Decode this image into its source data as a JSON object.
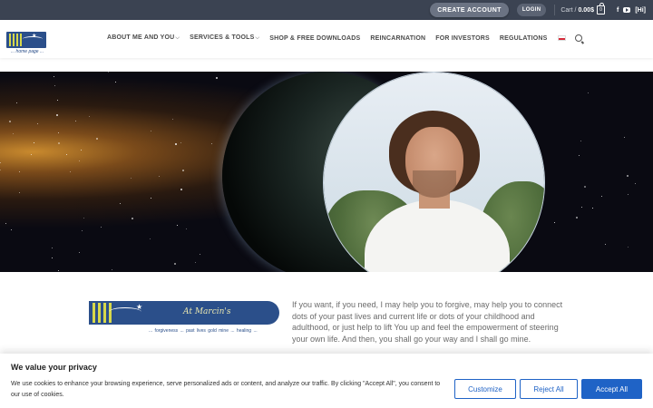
{
  "topbar": {
    "create_account": "CREATE ACCOUNT",
    "login": "LOGIN",
    "cart_label": "Cart /",
    "cart_total": "0.00$",
    "cart_count": "0",
    "facebook": "f",
    "hi": "[Hi]"
  },
  "header": {
    "logo_subtitle": "... home page ...",
    "nav": [
      {
        "label": "ABOUT ME AND YOU",
        "has_dropdown": true
      },
      {
        "label": "SERVICES & TOOLS",
        "has_dropdown": true
      },
      {
        "label": "SHOP & FREE DOWNLOADS",
        "has_dropdown": false
      },
      {
        "label": "REINCARNATION",
        "has_dropdown": false
      },
      {
        "label": "FOR INVESTORS",
        "has_dropdown": false
      },
      {
        "label": "REGULATIONS",
        "has_dropdown": false
      }
    ],
    "dropdown_glyph": "⌵"
  },
  "content": {
    "brand_title": "At Marcin's",
    "brand_tagline": "... forgiveness ... past lives gold mine ... healing ...",
    "intro": "If you want, if you need, I may help you to forgive, may help you to connect dots of your past lives and current life or dots of your childhood and adulthood, or just help to lift You up and feel the empowerment of steering your own life. And then, you shall go your way and I shall go mine."
  },
  "cookie": {
    "title": "We value your privacy",
    "text": "We use cookies to enhance your browsing experience, serve personalized ads or content, and analyze our traffic. By clicking \"Accept All\", you consent to our use of cookies.",
    "customize": "Customize",
    "reject": "Reject All",
    "accept": "Accept All"
  },
  "colors": {
    "topbar": "#3b4352",
    "brand_blue": "#2b4f8a",
    "accent_yellow": "#d7d84a",
    "cookie_button": "#1f63c6"
  }
}
